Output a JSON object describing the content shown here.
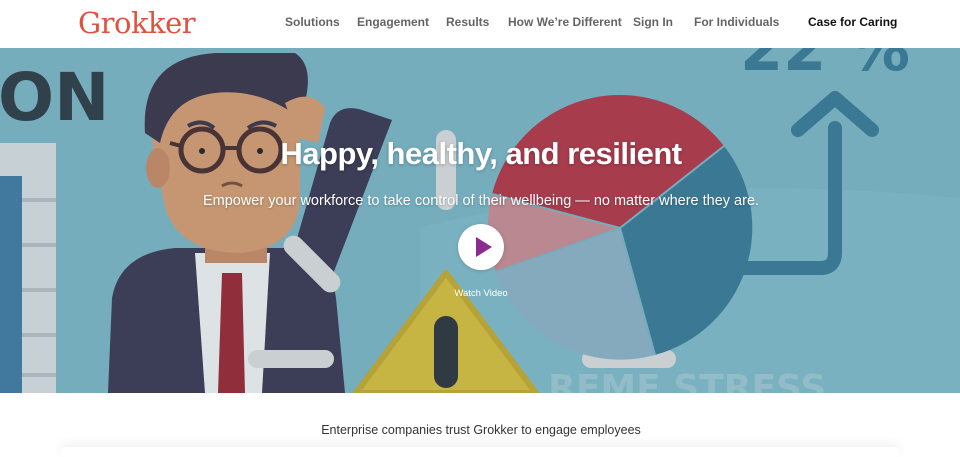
{
  "brand": {
    "logo_text": "Grokker"
  },
  "nav": {
    "items": [
      {
        "label": "Solutions"
      },
      {
        "label": "Engagement"
      },
      {
        "label": "Results"
      },
      {
        "label": "How We’re Different"
      },
      {
        "label": "Sign In"
      },
      {
        "label": "For Individuals"
      }
    ],
    "cta_label": "Case for Caring"
  },
  "hero": {
    "title": "Happy, healthy, and resilient",
    "subtitle": "Empower your workforce to take control of their wellbeing — no matter where they are.",
    "video_label": "Watch Video",
    "illustration_text": {
      "left": "ON",
      "top_right": "22 %",
      "bottom": "REME STRESS"
    }
  },
  "trust": {
    "text": "Enterprise companies trust Grokker to engage employees"
  },
  "colors": {
    "brand_red": "#e2513f",
    "hero_bg": "#74aebf",
    "play_accent": "#8b2a8f",
    "pie_red": "#b43445",
    "pie_blue": "#3a7895"
  }
}
